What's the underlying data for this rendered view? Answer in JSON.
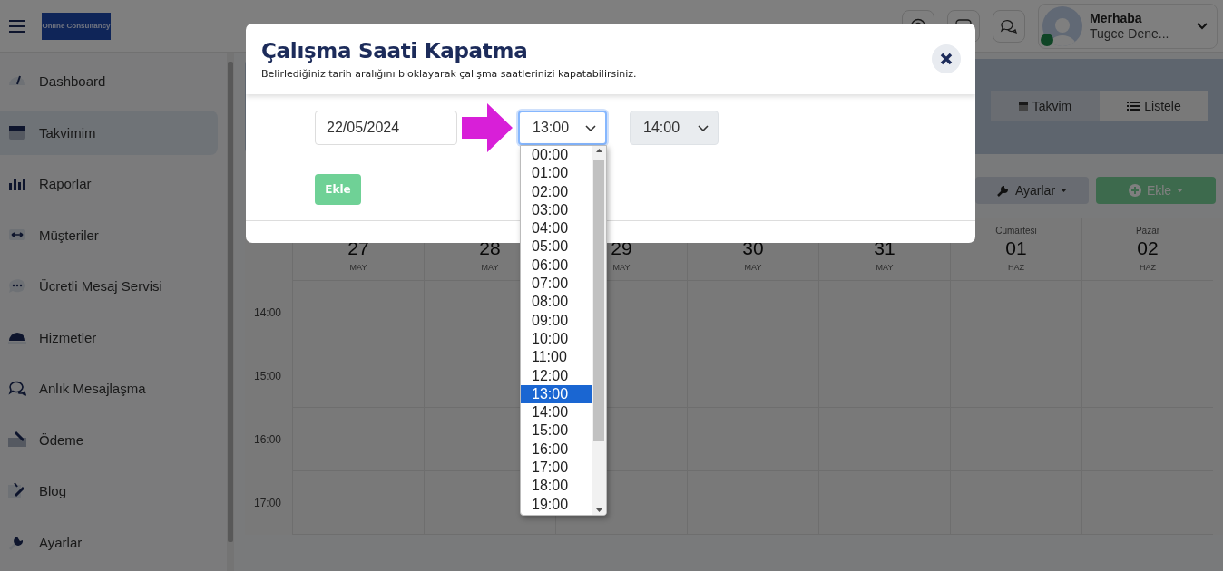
{
  "header": {
    "logo": "Online Consultancy",
    "user": {
      "greeting": "Merhaba",
      "name": "Tugce Dene...",
      "online": true
    }
  },
  "sidebar": {
    "items": [
      {
        "label": "Dashboard",
        "selected": false
      },
      {
        "label": "Takvimim",
        "selected": true
      },
      {
        "label": "Raporlar",
        "selected": false
      },
      {
        "label": "Müşteriler",
        "selected": false
      },
      {
        "label": "Ücretli Mesaj Servisi",
        "selected": false
      },
      {
        "label": "Hizmetler",
        "selected": false
      },
      {
        "label": "Anlık Mesajlaşma",
        "selected": false
      },
      {
        "label": "Ödeme",
        "selected": false
      },
      {
        "label": "Blog",
        "selected": false
      },
      {
        "label": "Ayarlar",
        "selected": false
      }
    ]
  },
  "view_toggle": [
    {
      "label": "Takvim",
      "selected": false
    },
    {
      "label": "Listele",
      "selected": true
    }
  ],
  "toolbar": {
    "settings": "Ayarlar",
    "add": "Ekle"
  },
  "calendar": {
    "days": [
      {
        "day": "27",
        "month": "MAY"
      },
      {
        "day": "28",
        "month": "MAY"
      },
      {
        "day": "29",
        "month": "MAY"
      },
      {
        "day": "30",
        "month": "MAY"
      },
      {
        "day": "31",
        "month": "MAY"
      },
      {
        "weekday": "Cumartesi",
        "day": "01",
        "month": "HAZ"
      },
      {
        "weekday": "Pazar",
        "day": "02",
        "month": "HAZ"
      }
    ],
    "times": [
      "14:00",
      "15:00",
      "16:00",
      "17:00"
    ]
  },
  "modal": {
    "title": "Çalışma Saati Kapatma",
    "subtitle": "Belirlediğiniz tarih aralığını bloklayarak çalışma saatlerinizi kapatabilirsiniz.",
    "date": "22/05/2024",
    "start": {
      "value": "13:00",
      "focused": true
    },
    "end": {
      "value": "14:00",
      "disabled": true
    },
    "submit": {
      "label": "Ekle",
      "disabled": true
    },
    "dropdown": {
      "options": [
        {
          "label": "00:00",
          "selected": false
        },
        {
          "label": "01:00",
          "selected": false
        },
        {
          "label": "02:00",
          "selected": false
        },
        {
          "label": "03:00",
          "selected": false
        },
        {
          "label": "04:00",
          "selected": false
        },
        {
          "label": "05:00",
          "selected": false
        },
        {
          "label": "06:00",
          "selected": false
        },
        {
          "label": "07:00",
          "selected": false
        },
        {
          "label": "08:00",
          "selected": false
        },
        {
          "label": "09:00",
          "selected": false
        },
        {
          "label": "10:00",
          "selected": false
        },
        {
          "label": "11:00",
          "selected": false
        },
        {
          "label": "12:00",
          "selected": false
        },
        {
          "label": "13:00",
          "selected": true
        },
        {
          "label": "14:00",
          "selected": false
        },
        {
          "label": "15:00",
          "selected": false
        },
        {
          "label": "16:00",
          "selected": false
        },
        {
          "label": "17:00",
          "selected": false
        },
        {
          "label": "18:00",
          "selected": false
        },
        {
          "label": "19:00",
          "selected": false
        }
      ]
    }
  }
}
